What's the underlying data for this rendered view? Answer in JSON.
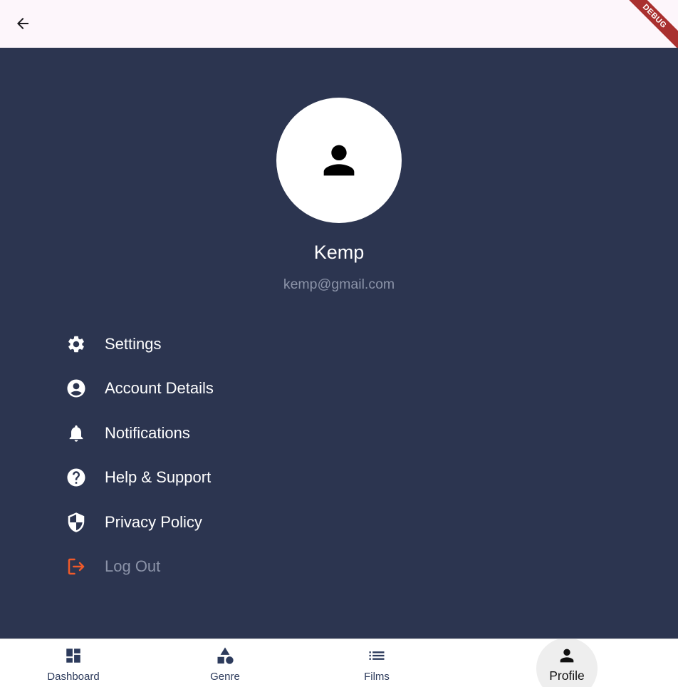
{
  "appbar": {
    "back_icon": "arrow-back-icon",
    "debug_banner": "DEBUG"
  },
  "profile": {
    "avatar_icon": "person-icon",
    "name": "Kemp",
    "email": "kemp@gmail.com"
  },
  "menu": [
    {
      "label": "Settings",
      "icon": "gear-icon"
    },
    {
      "label": "Account Details",
      "icon": "account-circle-icon"
    },
    {
      "label": "Notifications",
      "icon": "bell-icon"
    },
    {
      "label": "Help & Support",
      "icon": "help-circle-icon"
    },
    {
      "label": "Privacy Policy",
      "icon": "shield-icon"
    },
    {
      "label": "Log Out",
      "icon": "logout-icon"
    }
  ],
  "bottom_nav": [
    {
      "label": "Dashboard",
      "icon": "dashboard-icon"
    },
    {
      "label": "Genre",
      "icon": "category-icon"
    },
    {
      "label": "Films",
      "icon": "list-icon"
    },
    {
      "label": "Profile",
      "icon": "person-icon",
      "selected": true
    }
  ],
  "colors": {
    "background": "#2c3550",
    "appbar": "#fdf6fb",
    "logout_icon": "#f05a2a",
    "muted_text": "#8b93a8",
    "nav_icon": "#2d3b5c"
  }
}
